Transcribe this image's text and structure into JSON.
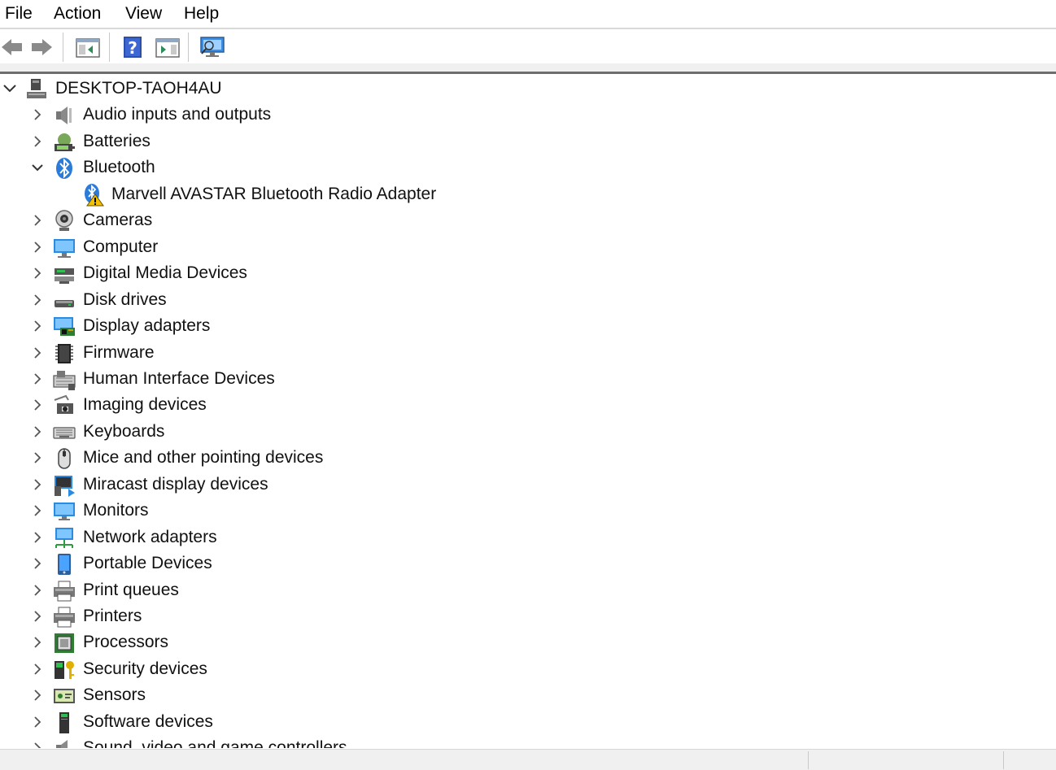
{
  "menu": {
    "file": "File",
    "action": "Action",
    "view": "View",
    "help": "Help"
  },
  "toolbar": {
    "buttons": [
      "back-icon",
      "forward-icon",
      "show-hide-console-tree-icon",
      "help-icon",
      "show-action-pane-icon",
      "scan-hardware-icon"
    ]
  },
  "tree": {
    "root": "DESKTOP-TAOH4AU",
    "categories": [
      {
        "label": "Audio inputs and outputs",
        "icon": "speaker-icon"
      },
      {
        "label": "Batteries",
        "icon": "battery-icon"
      },
      {
        "label": "Bluetooth",
        "icon": "bluetooth-icon",
        "expanded": true
      },
      {
        "label": "Cameras",
        "icon": "camera-icon"
      },
      {
        "label": "Computer",
        "icon": "computer-icon"
      },
      {
        "label": "Digital Media Devices",
        "icon": "media-device-icon"
      },
      {
        "label": "Disk drives",
        "icon": "disk-drive-icon"
      },
      {
        "label": "Display adapters",
        "icon": "display-adapter-icon"
      },
      {
        "label": "Firmware",
        "icon": "firmware-icon"
      },
      {
        "label": "Human Interface Devices",
        "icon": "hid-icon"
      },
      {
        "label": "Imaging devices",
        "icon": "imaging-icon"
      },
      {
        "label": "Keyboards",
        "icon": "keyboard-icon"
      },
      {
        "label": "Mice and other pointing devices",
        "icon": "mouse-icon"
      },
      {
        "label": "Miracast display devices",
        "icon": "miracast-icon"
      },
      {
        "label": "Monitors",
        "icon": "monitor-icon"
      },
      {
        "label": "Network adapters",
        "icon": "network-icon"
      },
      {
        "label": "Portable Devices",
        "icon": "portable-device-icon"
      },
      {
        "label": "Print queues",
        "icon": "print-queue-icon"
      },
      {
        "label": "Printers",
        "icon": "printer-icon"
      },
      {
        "label": "Processors",
        "icon": "processor-icon"
      },
      {
        "label": "Security devices",
        "icon": "security-icon"
      },
      {
        "label": "Sensors",
        "icon": "sensor-icon"
      },
      {
        "label": "Software devices",
        "icon": "software-device-icon"
      },
      {
        "label": "Sound, video and game controllers",
        "icon": "sound-controller-icon"
      }
    ],
    "bluetooth_child": {
      "label": "Marvell AVASTAR Bluetooth Radio Adapter",
      "icon": "bluetooth-warning-icon"
    }
  }
}
